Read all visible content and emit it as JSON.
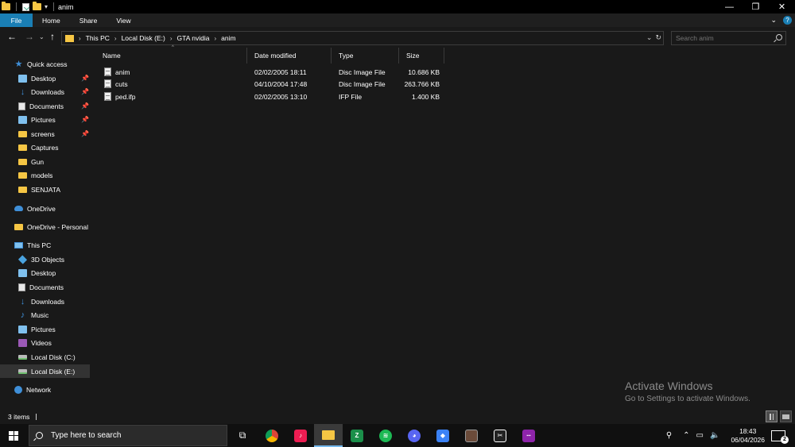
{
  "window": {
    "title": "anim",
    "controls": [
      "—",
      "❐",
      "✕"
    ]
  },
  "ribbon": {
    "tabs": [
      "File",
      "Home",
      "Share",
      "View"
    ],
    "expand_icon": "chevron-down-icon",
    "help_icon": "help-icon"
  },
  "address": {
    "breadcrumbs": [
      "This PC",
      "Local Disk (E:)",
      "GTA nvidia",
      "anim"
    ]
  },
  "search": {
    "placeholder": "Search anim"
  },
  "sidebar": {
    "items": [
      {
        "label": "Quick access",
        "icon": "star-icon"
      },
      {
        "label": "Desktop",
        "icon": "desktop-icon",
        "pinned": true
      },
      {
        "label": "Downloads",
        "icon": "download-icon",
        "pinned": true
      },
      {
        "label": "Documents",
        "icon": "documents-icon",
        "pinned": true
      },
      {
        "label": "Pictures",
        "icon": "pictures-icon",
        "pinned": true
      },
      {
        "label": "screens",
        "icon": "folder-icon",
        "pinned": true
      },
      {
        "label": "Captures",
        "icon": "folder-icon"
      },
      {
        "label": "Gun",
        "icon": "folder-icon"
      },
      {
        "label": "models",
        "icon": "folder-icon"
      },
      {
        "label": "SENJATA",
        "icon": "folder-icon"
      },
      {
        "label": "OneDrive",
        "icon": "cloud-icon"
      },
      {
        "label": "OneDrive - Personal",
        "icon": "folder-icon"
      },
      {
        "label": "This PC",
        "icon": "computer-icon"
      },
      {
        "label": "3D Objects",
        "icon": "cube-icon"
      },
      {
        "label": "Desktop",
        "icon": "desktop-icon"
      },
      {
        "label": "Documents",
        "icon": "documents-icon"
      },
      {
        "label": "Downloads",
        "icon": "download-icon"
      },
      {
        "label": "Music",
        "icon": "music-icon"
      },
      {
        "label": "Pictures",
        "icon": "pictures-icon"
      },
      {
        "label": "Videos",
        "icon": "video-icon"
      },
      {
        "label": "Local Disk (C:)",
        "icon": "drive-icon"
      },
      {
        "label": "Local Disk (E:)",
        "icon": "drive-icon",
        "selected": true
      },
      {
        "label": "Network",
        "icon": "network-icon"
      }
    ]
  },
  "columns": [
    "Name",
    "Date modified",
    "Type",
    "Size"
  ],
  "files": [
    {
      "name": "anim",
      "date": "02/02/2005 18:11",
      "type": "Disc Image File",
      "size": "10.686 KB"
    },
    {
      "name": "cuts",
      "date": "04/10/2004 17:48",
      "type": "Disc Image File",
      "size": "263.766 KB"
    },
    {
      "name": "ped.ifp",
      "date": "02/02/2005 13:10",
      "type": "IFP File",
      "size": "1.400 KB"
    }
  ],
  "watermark": {
    "line1": "Activate Windows",
    "line2": "Go to Settings to activate Windows."
  },
  "status": {
    "count": "3 items"
  },
  "taskbar": {
    "search_placeholder": "Type here to search",
    "time": "18:43",
    "date": "06/04/2026",
    "notification_count": "2"
  }
}
